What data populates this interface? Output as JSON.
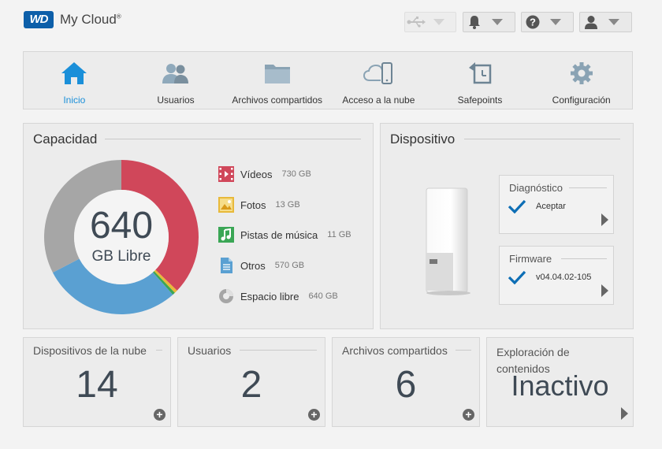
{
  "header": {
    "brand_badge": "WD",
    "brand_name": "My Cloud",
    "brand_mark": "®",
    "buttons": [
      {
        "icon": "usb-icon"
      },
      {
        "icon": "bell-icon"
      },
      {
        "icon": "help-icon"
      },
      {
        "icon": "user-icon"
      }
    ]
  },
  "nav": {
    "items": [
      {
        "label": "Inicio",
        "icon": "home-icon",
        "active": true
      },
      {
        "label": "Usuarios",
        "icon": "users-icon"
      },
      {
        "label": "Archivos compartidos",
        "icon": "folder-icon"
      },
      {
        "label": "Acceso a la nube",
        "icon": "cloud-phone-icon"
      },
      {
        "label": "Safepoints",
        "icon": "safepoint-icon"
      },
      {
        "label": "Configuración",
        "icon": "gear-icon"
      }
    ],
    "active_color": "#1a8fd9"
  },
  "capacity": {
    "title": "Capacidad",
    "free_value": "640",
    "free_unit": "GB",
    "free_label": "Libre",
    "legend": [
      {
        "name": "Vídeos",
        "value": "730 GB",
        "color": "#d0475a"
      },
      {
        "name": "Fotos",
        "value": "13 GB",
        "color": "#e8b93a"
      },
      {
        "name": "Pistas de música",
        "value": "11 GB",
        "color": "#3aa655"
      },
      {
        "name": "Otros",
        "value": "570 GB",
        "color": "#5aa0d2"
      },
      {
        "name": "Espacio libre",
        "value": "640 GB",
        "color": "#a6a6a6"
      }
    ]
  },
  "chart_data": {
    "type": "pie",
    "categories": [
      "Vídeos",
      "Fotos",
      "Pistas de música",
      "Otros",
      "Espacio libre"
    ],
    "values": [
      730,
      13,
      11,
      570,
      640
    ],
    "colors": [
      "#d0475a",
      "#e8b93a",
      "#3aa655",
      "#5aa0d2",
      "#a6a6a6"
    ]
  },
  "device": {
    "title": "Dispositivo",
    "diagnostics": {
      "title": "Diagnóstico",
      "value": "Aceptar"
    },
    "firmware": {
      "title": "Firmware",
      "value": "v04.04.02-105"
    },
    "check_color": "#0d6eb5"
  },
  "tiles": [
    {
      "title": "Dispositivos de la nube",
      "value": "14"
    },
    {
      "title": "Usuarios",
      "value": "2"
    },
    {
      "title": "Archivos compartidos",
      "value": "6"
    },
    {
      "title_line1": "Exploración de",
      "title_line2": "contenidos",
      "value": "Inactivo"
    }
  ]
}
